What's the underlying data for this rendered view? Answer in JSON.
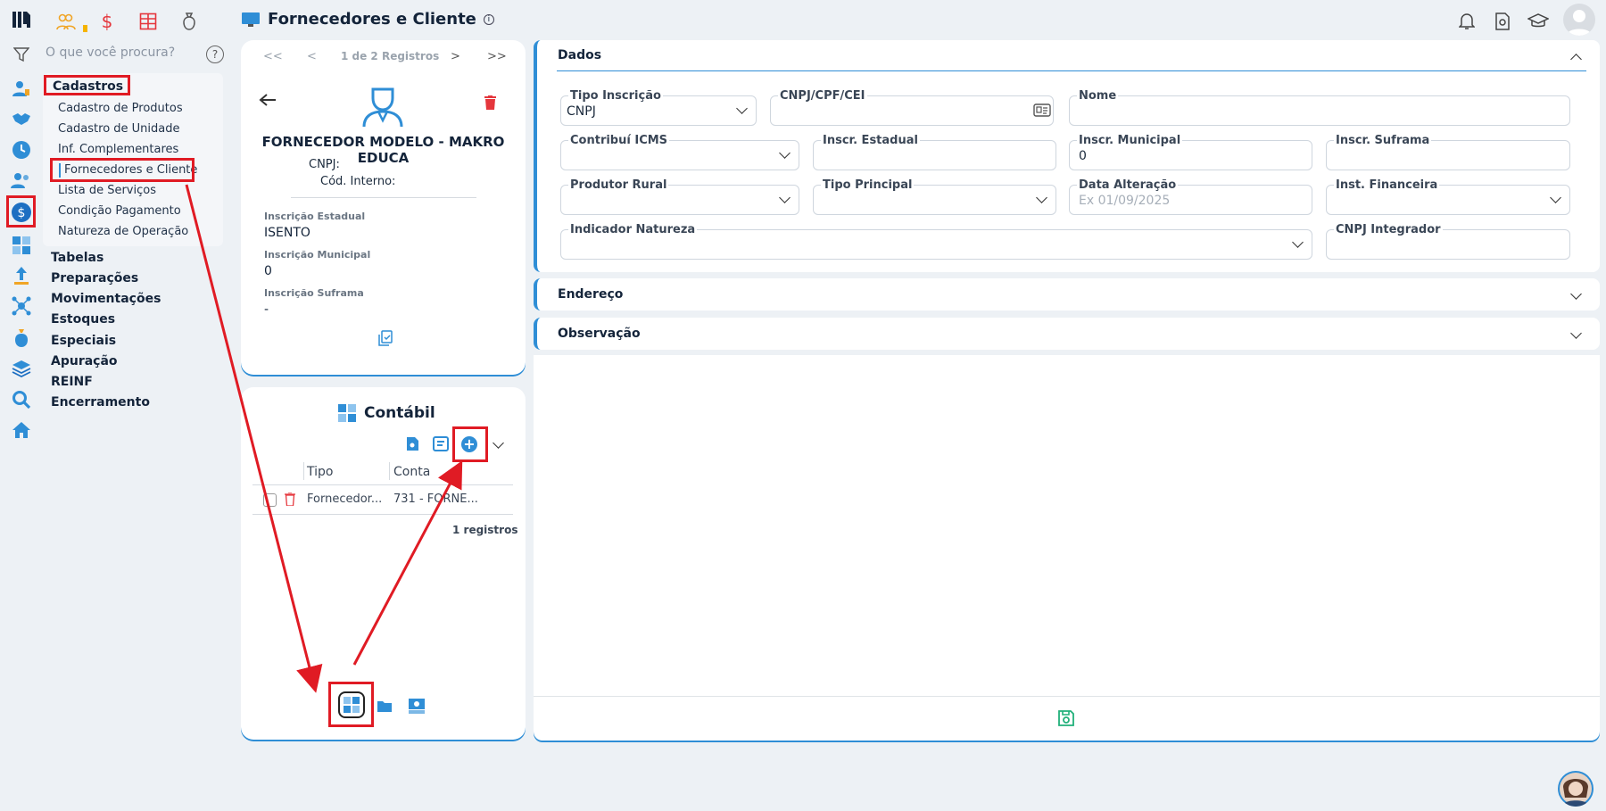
{
  "header": {
    "title": "Fornecedores e Cliente",
    "info_icon": "i"
  },
  "search": {
    "placeholder": "O que você procura?",
    "help": "?"
  },
  "menu": {
    "cadastros": "Cadastros",
    "sub_items": [
      "Cadastro de Produtos",
      "Cadastro de Unidade",
      "Inf. Complementares",
      "Fornecedores e Cliente",
      "Lista de Serviços",
      "Condição Pagamento",
      "Natureza de Operação"
    ],
    "sections": [
      "Tabelas",
      "Preparações",
      "Movimentações",
      "Estoques",
      "Especiais",
      "Apuração",
      "REINF",
      "Encerramento"
    ]
  },
  "record": {
    "nav_first": "<<",
    "nav_prev": "<",
    "position": "1 de 2 Registros",
    "nav_next": ">",
    "nav_last": ">>",
    "name": "FORNECEDOR MODELO - MAKRO EDUCA",
    "cnpj_label": "CNPJ:",
    "cod_label": "Cód. Interno:",
    "inscricao_estadual_label": "Inscrição Estadual",
    "inscricao_estadual": "ISENTO",
    "inscricao_municipal_label": "Inscrição Municipal",
    "inscricao_municipal": "0",
    "inscricao_suframa_label": "Inscrição Suframa",
    "inscricao_suframa": "-"
  },
  "contabil": {
    "title": "Contábil",
    "col_tipo": "Tipo",
    "col_conta": "Conta",
    "rows": [
      {
        "tipo": "Fornecedor...",
        "conta": "731 - FORNE..."
      }
    ],
    "count": "1 registros"
  },
  "dados": {
    "title": "Dados",
    "tipo_inscricao_label": "Tipo Inscrição",
    "tipo_inscricao": "CNPJ",
    "cnpj_label": "CNPJ/CPF/CEI",
    "nome_label": "Nome",
    "icms_label": "Contribuí ICMS",
    "inscr_estadual_label": "Inscr. Estadual",
    "inscr_municipal_label": "Inscr. Municipal",
    "inscr_municipal": "0",
    "inscr_suframa_label": "Inscr. Suframa",
    "produtor_label": "Produtor Rural",
    "tipo_principal_label": "Tipo Principal",
    "data_alteracao_label": "Data Alteração",
    "data_alteracao_placeholder": "Ex 01/09/2025",
    "inst_financeira_label": "Inst. Financeira",
    "indicador_label": "Indicador Natureza",
    "cnpj_integrador_label": "CNPJ Integrador"
  },
  "endereco": {
    "title": "Endereço"
  },
  "observacao": {
    "title": "Observação"
  },
  "colors": {
    "accent": "#2f8ed6",
    "annotation": "#e01b24",
    "delete": "#e5363c",
    "save": "#21b07a"
  }
}
